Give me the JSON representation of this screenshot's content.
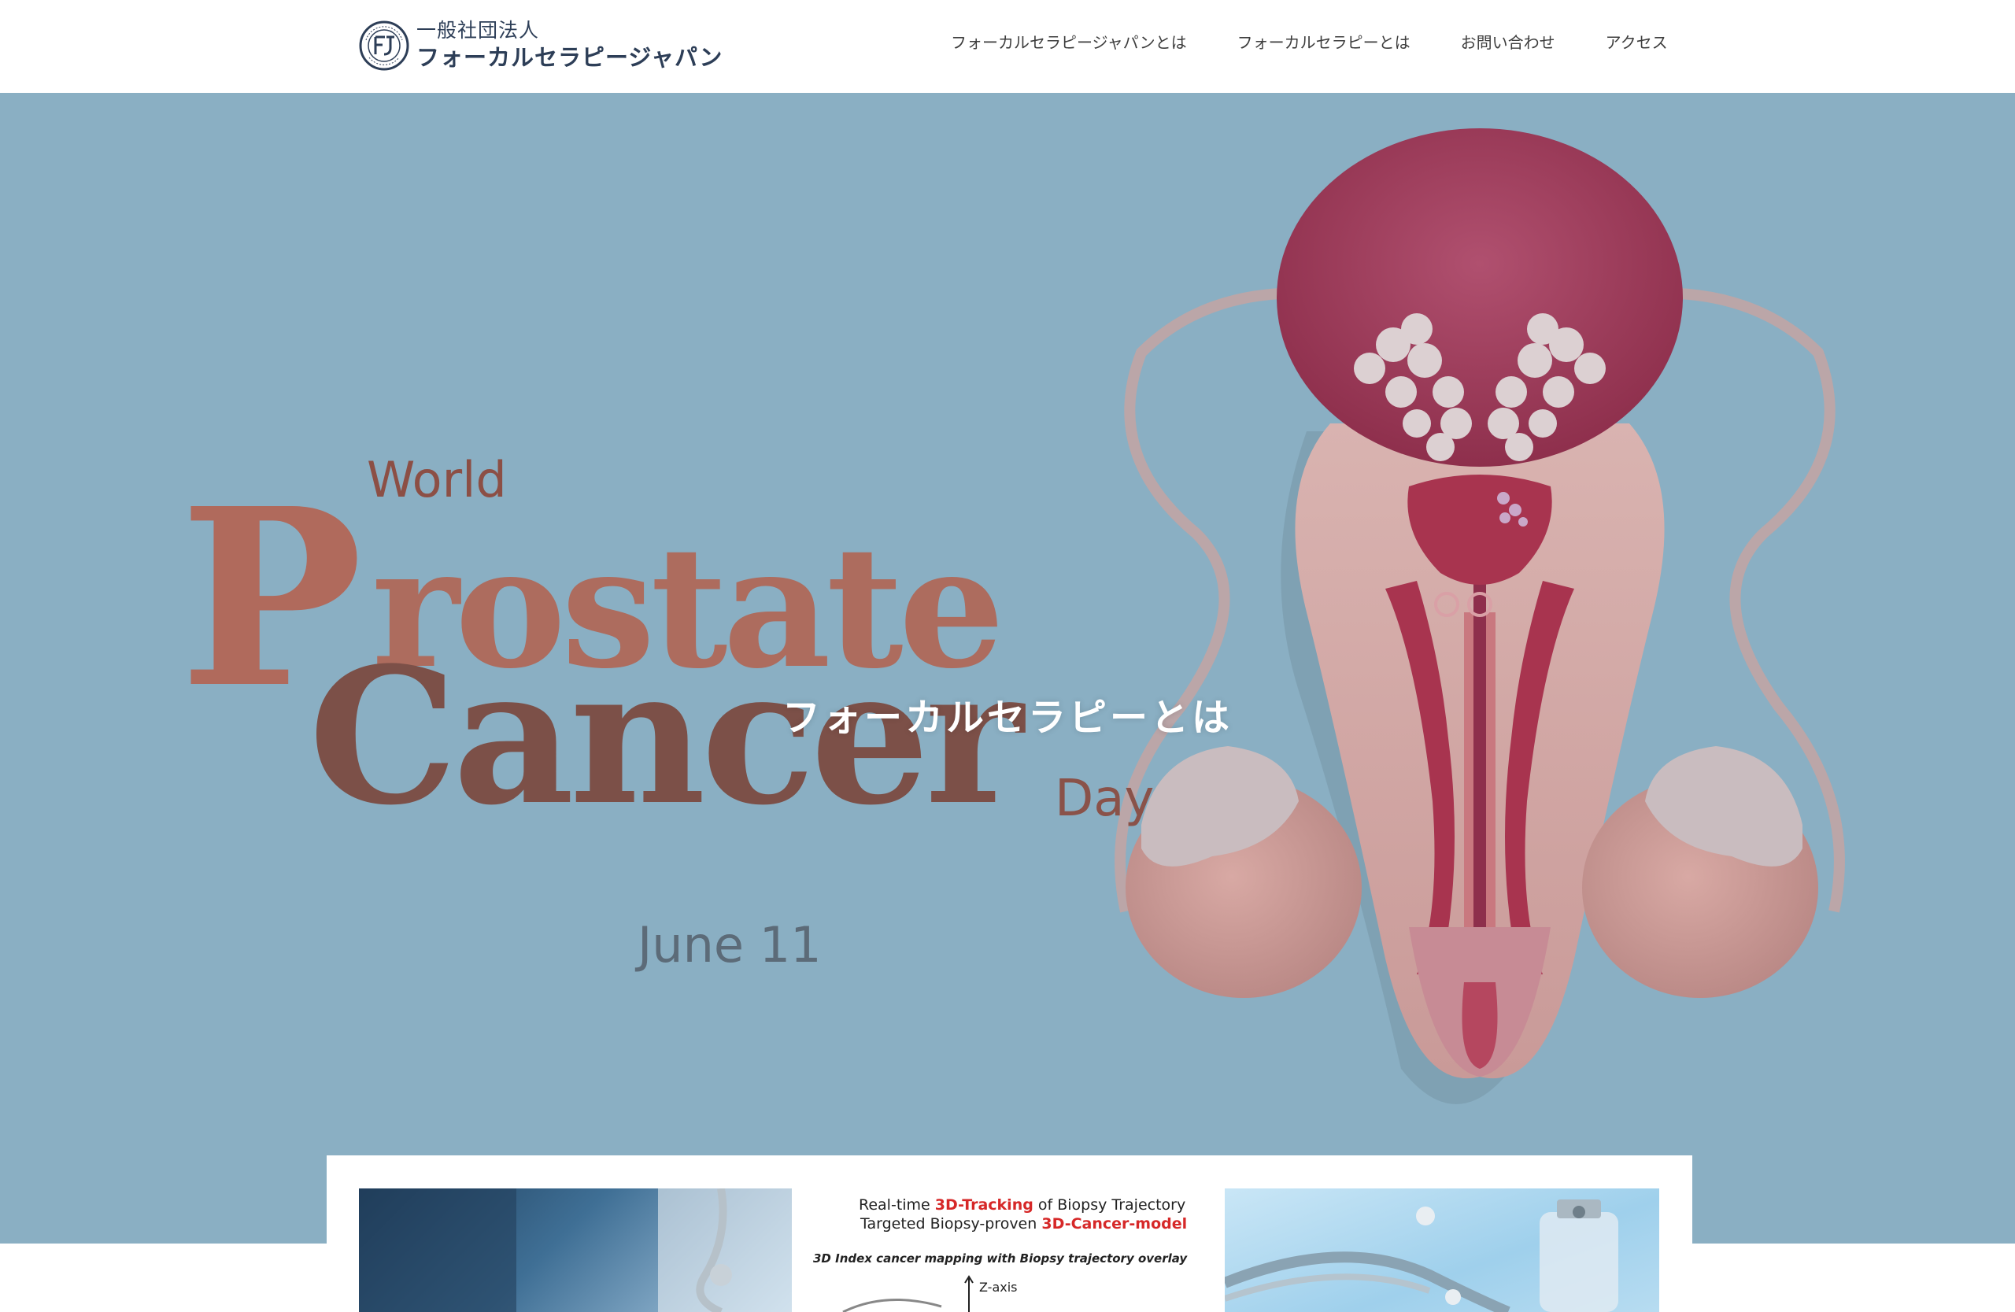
{
  "header": {
    "logo_sub": "一般社団法人",
    "logo_main": "フォーカルセラピージャパン",
    "nav": [
      {
        "label": "フォーカルセラピージャパンとは"
      },
      {
        "label": "フォーカルセラピーとは"
      },
      {
        "label": "お問い合わせ"
      },
      {
        "label": "アクセス"
      }
    ]
  },
  "hero": {
    "title": "フォーカルセラピーとは",
    "poster": {
      "world": "World",
      "p": "P",
      "rostate": "rostate",
      "cancer": "Cancer",
      "day": "Day",
      "date": "June 11"
    },
    "background": "#8aafc3"
  },
  "cards": {
    "card2": {
      "line1_pre": "Real-time ",
      "line1_red": "3D-Tracking",
      "line1_post": " of Biopsy Trajectory",
      "line2_pre": "Targeted Biopsy-proven ",
      "line2_red": "3D-Cancer-model",
      "line3": "3D Index cancer mapping with Biopsy trajectory overlay",
      "axis": "Z-axis"
    }
  },
  "colors": {
    "accent_red": "#d62828",
    "header_text": "#2d3e57"
  }
}
